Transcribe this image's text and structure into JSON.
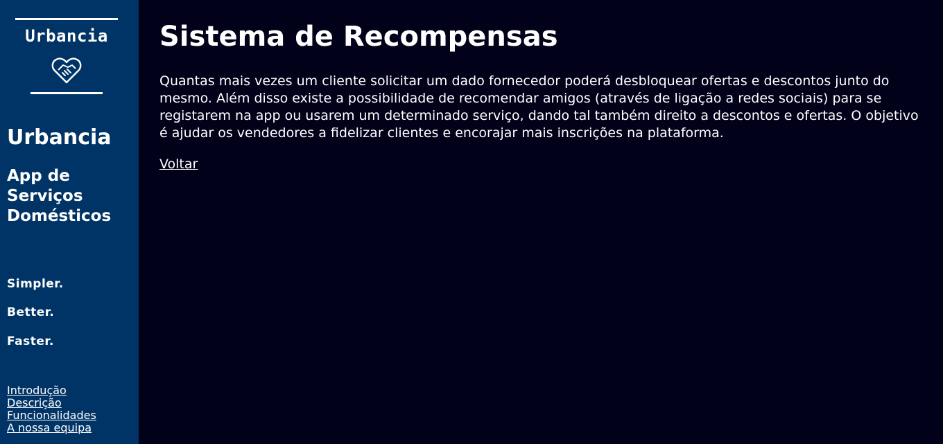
{
  "sidebar": {
    "logo_text": "Urbancia",
    "logo_icon": "handshake-heart-icon",
    "title": "Urbancia",
    "subtitle": "App de Serviços Domésticos",
    "slogans": [
      "Simpler.",
      "Better.",
      "Faster."
    ],
    "nav": [
      "Introdução",
      "Descrição",
      "Funcionalidades",
      "A nossa equipa"
    ]
  },
  "main": {
    "title": "Sistema de Recompensas",
    "description": "Quantas mais vezes um cliente solicitar um dado fornecedor poderá desbloquear ofertas e descontos junto do mesmo. Além disso existe a possibilidade de recomendar amigos (através de ligação a redes sociais) para se registarem na app ou usarem um determinado serviço, dando tal também direito a descontos e ofertas. O objetivo é ajudar os vendedores a fidelizar clientes e encorajar mais inscrições na plataforma.",
    "back_link": "Voltar"
  },
  "colors": {
    "sidebar_bg": "#013466",
    "page_bg": "#01011a",
    "text": "#ffffff"
  }
}
